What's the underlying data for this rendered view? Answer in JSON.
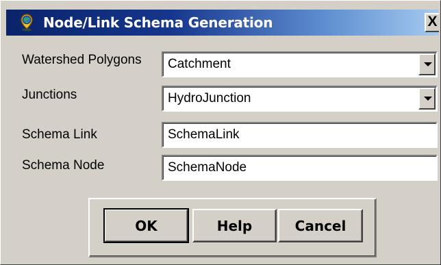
{
  "window": {
    "title": "Node/Link Schema Generation",
    "close_label": "X"
  },
  "form": {
    "watershed_polygons": {
      "label": "Watershed Polygons",
      "value": "Catchment"
    },
    "junctions": {
      "label": "Junctions",
      "value": "HydroJunction"
    },
    "schema_link": {
      "label": "Schema Link",
      "value": "SchemaLink"
    },
    "schema_node": {
      "label": "Schema Node",
      "value": "SchemaNode"
    }
  },
  "buttons": {
    "ok": "OK",
    "help": "Help",
    "cancel": "Cancel"
  },
  "icons": {
    "app": "globe-pin-icon",
    "close": "close-icon",
    "dropdown": "chevron-down-icon"
  },
  "colors": {
    "dialog_background": "#d4d0c8",
    "titlebar_start": "#0a246a",
    "titlebar_end": "#a6caf0",
    "field_background": "#ffffff"
  }
}
